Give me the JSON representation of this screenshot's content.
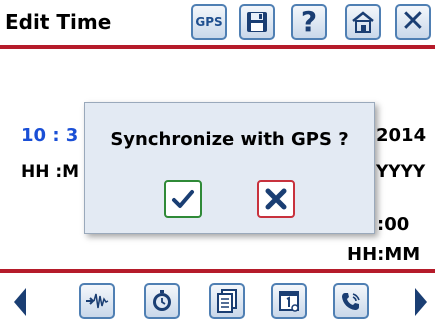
{
  "header": {
    "title": "Edit Time",
    "gps_label": "GPS",
    "help_label": "?",
    "close_label": "✕"
  },
  "form": {
    "date_value_fragment": "10 : 3",
    "year_value": "2014",
    "time_format_fragment": "HH :M",
    "year_format_fragment": "YYYY",
    "offset_value": ":00",
    "offset_format": "HH:MM"
  },
  "dialog": {
    "message": "Synchronize with GPS ?",
    "confirm_icon": "checkmark-icon",
    "cancel_icon": "close-icon"
  },
  "footer": {
    "buttons": [
      "signal-icon",
      "clock-icon",
      "documents-icon",
      "calendar-icon",
      "phone-icon"
    ]
  },
  "colors": {
    "accent_red": "#b51b2a",
    "accent_blue": "#1a3e73",
    "date_blue": "#1a4fd6",
    "ok_green": "#2f8a37",
    "cancel_red": "#c8323d"
  }
}
